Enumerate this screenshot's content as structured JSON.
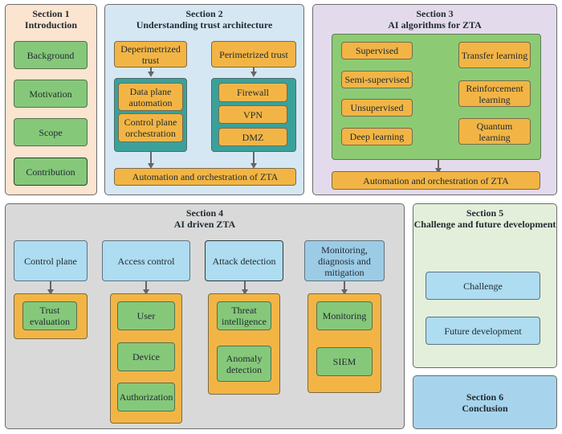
{
  "section1": {
    "title_line1": "Section 1",
    "title_line2": "Introduction",
    "items": [
      "Background",
      "Motivation",
      "Scope",
      "Contribution"
    ]
  },
  "section2": {
    "title_line1": "Section 2",
    "title_line2": "Understanding trust architecture",
    "left_header": "Deperimetrized trust",
    "right_header": "Perimetrized trust",
    "left_items": [
      "Data plane automation",
      "Control plane orchestration"
    ],
    "right_items": [
      "Firewall",
      "VPN",
      "DMZ"
    ],
    "footer": "Automation and orchestration of ZTA"
  },
  "section3": {
    "title_line1": "Section 3",
    "title_line2": "AI algorithms for ZTA",
    "left_items": [
      "Supervised",
      "Semi-supervised",
      "Unsupervised",
      "Deep learning"
    ],
    "right_items": [
      "Transfer learning",
      "Reinforcement learning",
      "Quantum learning"
    ],
    "footer": "Automation and orchestration of ZTA"
  },
  "section4": {
    "title_line1": "Section 4",
    "title_line2": "AI driven ZTA",
    "columns": [
      {
        "header": "Control plane",
        "items": [
          "Trust evaluation"
        ]
      },
      {
        "header": "Access control",
        "items": [
          "User",
          "Device",
          "Authorization"
        ]
      },
      {
        "header": "Attack detection",
        "items": [
          "Threat intelligence",
          "Anomaly detection"
        ]
      },
      {
        "header": "Monitoring, diagnosis and mitigation",
        "items": [
          "Monitoring",
          "SIEM"
        ]
      }
    ]
  },
  "section5": {
    "title_line1": "Section 5",
    "title_line2": "Challenge and future development",
    "items": [
      "Challenge",
      "Future development"
    ]
  },
  "section6": {
    "title_line1": "Section 6",
    "title_line2": "Conclusion"
  }
}
